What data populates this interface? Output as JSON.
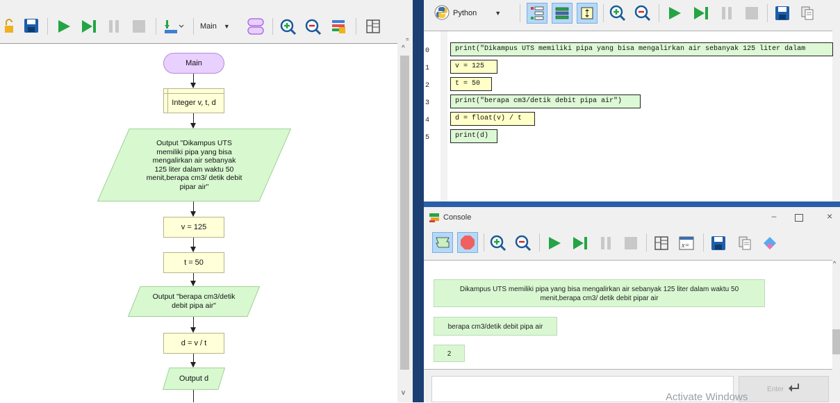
{
  "left_toolbar": {
    "function_selector": "Main",
    "icons": [
      "lock-icon",
      "save-icon",
      "run-icon",
      "step-icon",
      "pause-icon",
      "stop-icon",
      "add-function-icon",
      "oval-function-icon",
      "zoom-in-icon",
      "zoom-out-icon",
      "layers-icon",
      "layout-icon"
    ]
  },
  "flowchart": {
    "start": "Main",
    "declare": "Integer v, t, d",
    "output1": [
      "Output \"Dikampus UTS",
      "memiliki pipa yang bisa",
      "mengalirkan air sebanyak",
      "125 liter dalam waktu 50",
      "menit,berapa cm3/ detik debit",
      "pipar air\""
    ],
    "assign_v": "v = 125",
    "assign_t": "t = 50",
    "output2": [
      "Output \"berapa cm3/detik",
      "debit pipa air\""
    ],
    "assign_d": "d = v / t",
    "output3": "Output d"
  },
  "code_panel": {
    "language": "Python",
    "lines": [
      {
        "num": "0",
        "code": "print(\"Dikampus UTS memiliki pipa yang bisa mengalirkan air sebanyak 125 liter dalam"
      },
      {
        "num": "1",
        "code": "v = 125"
      },
      {
        "num": "2",
        "code": "t = 50"
      },
      {
        "num": "3",
        "code": "print(\"berapa cm3/detik debit pipa air\")"
      },
      {
        "num": "4",
        "code": "d = float(v) / t"
      },
      {
        "num": "5",
        "code": "print(d)"
      }
    ]
  },
  "console": {
    "title": "Console",
    "outputs": [
      [
        "Dikampus UTS memiliki pipa yang bisa mengalirkan air sebanyak 125 liter dalam waktu 50",
        "menit,berapa cm3/ detik debit pipar air"
      ],
      [
        "berapa cm3/detik debit pipa air"
      ],
      [
        "2"
      ]
    ],
    "enter_label": "Enter",
    "watermark": "Activate Windows"
  },
  "colors": {
    "flow_yellow": "#ffffd8",
    "flow_green": "#d8f8d0",
    "flow_purple": "#e8d0ff",
    "run_green": "#25a445"
  }
}
